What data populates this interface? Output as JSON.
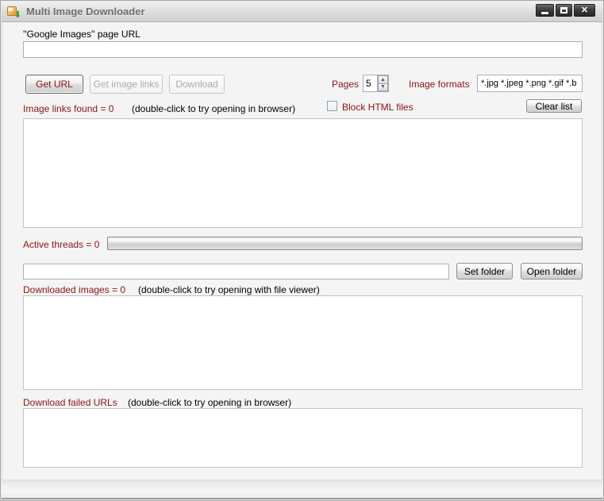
{
  "window": {
    "title": "Multi Image Downloader",
    "close_glyph": "✕"
  },
  "url_section": {
    "label": "''Google Images'' page URL",
    "value": ""
  },
  "toolbar": {
    "get_url_label": "Get URL",
    "get_image_links_label": "Get image links",
    "download_label": "Download",
    "pages_label": "Pages",
    "pages_value": "5",
    "spin_up_glyph": "▲",
    "spin_down_glyph": "▼",
    "image_formats_label": "Image formats",
    "image_formats_value": "*.jpg *.jpeg *.png *.gif *.b"
  },
  "links_section": {
    "count_label": "Image links found = 0",
    "hint": "(double-click to try opening in browser)",
    "block_html_label": "Block HTML files",
    "block_html_checked": false,
    "clear_list_label": "Clear list",
    "items": []
  },
  "threads_section": {
    "label": "Active threads = 0",
    "progress_percent": 0
  },
  "folder_section": {
    "path_value": "",
    "set_folder_label": "Set folder",
    "open_folder_label": "Open folder"
  },
  "downloaded_section": {
    "count_label": "Downloaded images = 0",
    "hint": "(double-click to try opening with file viewer)",
    "items": []
  },
  "failed_section": {
    "label": "Download failed URLs",
    "hint": "(double-click to try opening in browser)",
    "items": []
  },
  "colors": {
    "accent_red": "#8b1313",
    "titlebar_text": "#6e6e6e"
  }
}
